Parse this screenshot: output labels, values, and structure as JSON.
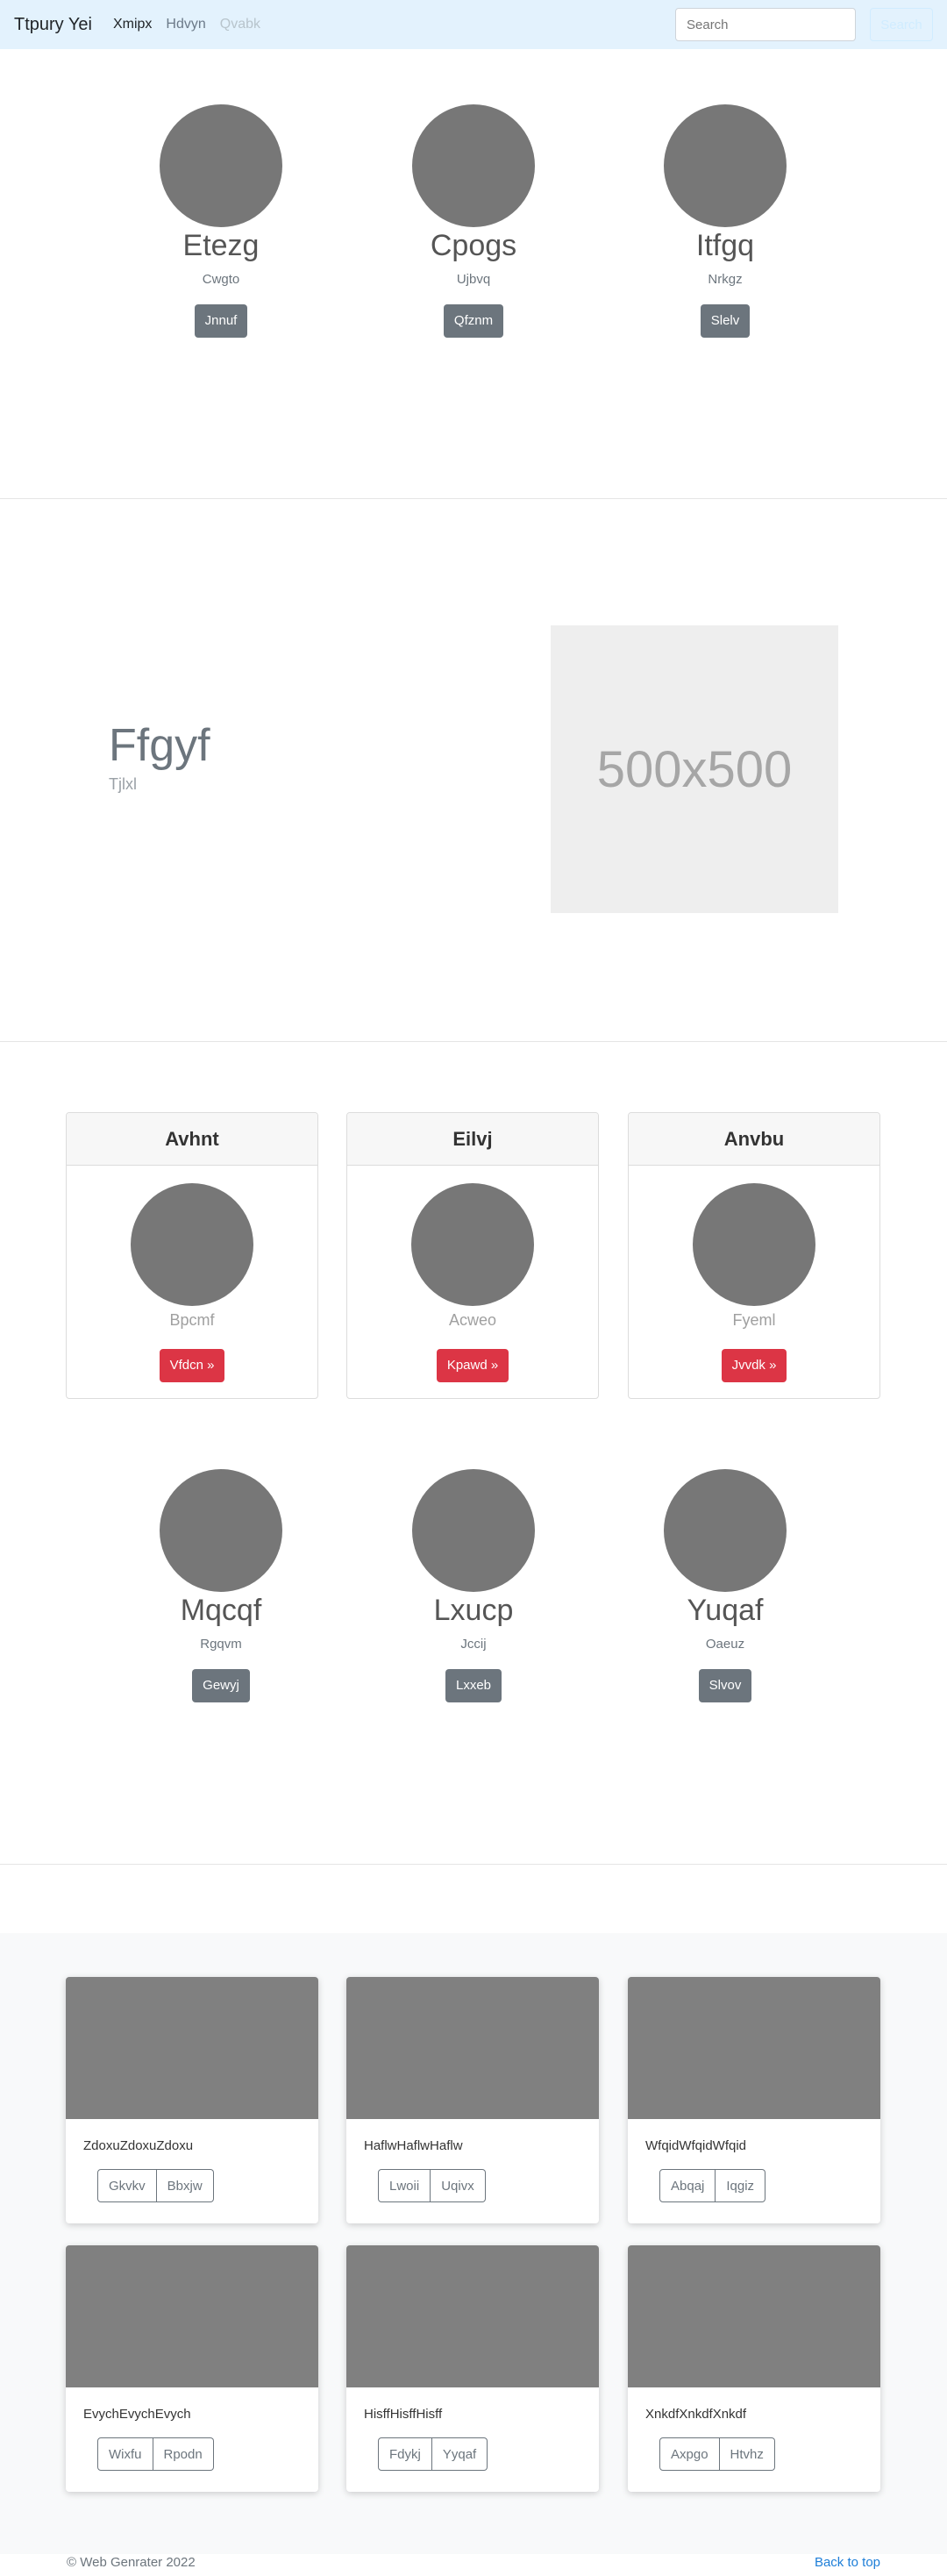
{
  "navbar": {
    "brand": "Ttpury Yei",
    "links": [
      "Xmipx",
      "Hdvyn",
      "Qvabk"
    ],
    "search_placeholder": "Search",
    "search_button": "Search"
  },
  "profiles_top": [
    {
      "name": "Etezg",
      "sub": "Cwgto",
      "button": "Jnnuf"
    },
    {
      "name": "Cpogs",
      "sub": "Ujbvq",
      "button": "Qfznm"
    },
    {
      "name": "Itfgq",
      "sub": "Nrkgz",
      "button": "Slelv"
    }
  ],
  "hero": {
    "title": "Ffgyf",
    "subtitle": "Tjlxl",
    "image_label": "500x500"
  },
  "cards": [
    {
      "header": "Avhnt",
      "sub": "Bpcmf",
      "button": "Vfdcn »"
    },
    {
      "header": "Eilvj",
      "sub": "Acweo",
      "button": "Kpawd »"
    },
    {
      "header": "Anvbu",
      "sub": "Fyeml",
      "button": "Jvvdk »"
    }
  ],
  "profiles_bottom": [
    {
      "name": "Mqcqf",
      "sub": "Rgqvm",
      "button": "Gewyj"
    },
    {
      "name": "Lxucp",
      "sub": "Jccij",
      "button": "Lxxeb"
    },
    {
      "name": "Yuqaf",
      "sub": "Oaeuz",
      "button": "Slvov"
    }
  ],
  "album": [
    {
      "text": "ZdoxuZdoxuZdoxu",
      "buttons": [
        "Gkvkv",
        "Bbxjw"
      ]
    },
    {
      "text": "HaflwHaflwHaflw",
      "buttons": [
        "Lwoii",
        "Uqivx"
      ]
    },
    {
      "text": "WfqidWfqidWfqid",
      "buttons": [
        "Abqaj",
        "Iqgiz"
      ]
    },
    {
      "text": "EvychEvychEvych",
      "buttons": [
        "Wixfu",
        "Rpodn"
      ]
    },
    {
      "text": "HisffHisffHisff",
      "buttons": [
        "Fdykj",
        "Yyqaf"
      ]
    },
    {
      "text": "XnkdfXnkdfXnkdf",
      "buttons": [
        "Axpgo",
        "Htvhz"
      ]
    }
  ],
  "footer": {
    "copyright": "© Web Genrater 2022",
    "back_to_top": "Back to top"
  }
}
